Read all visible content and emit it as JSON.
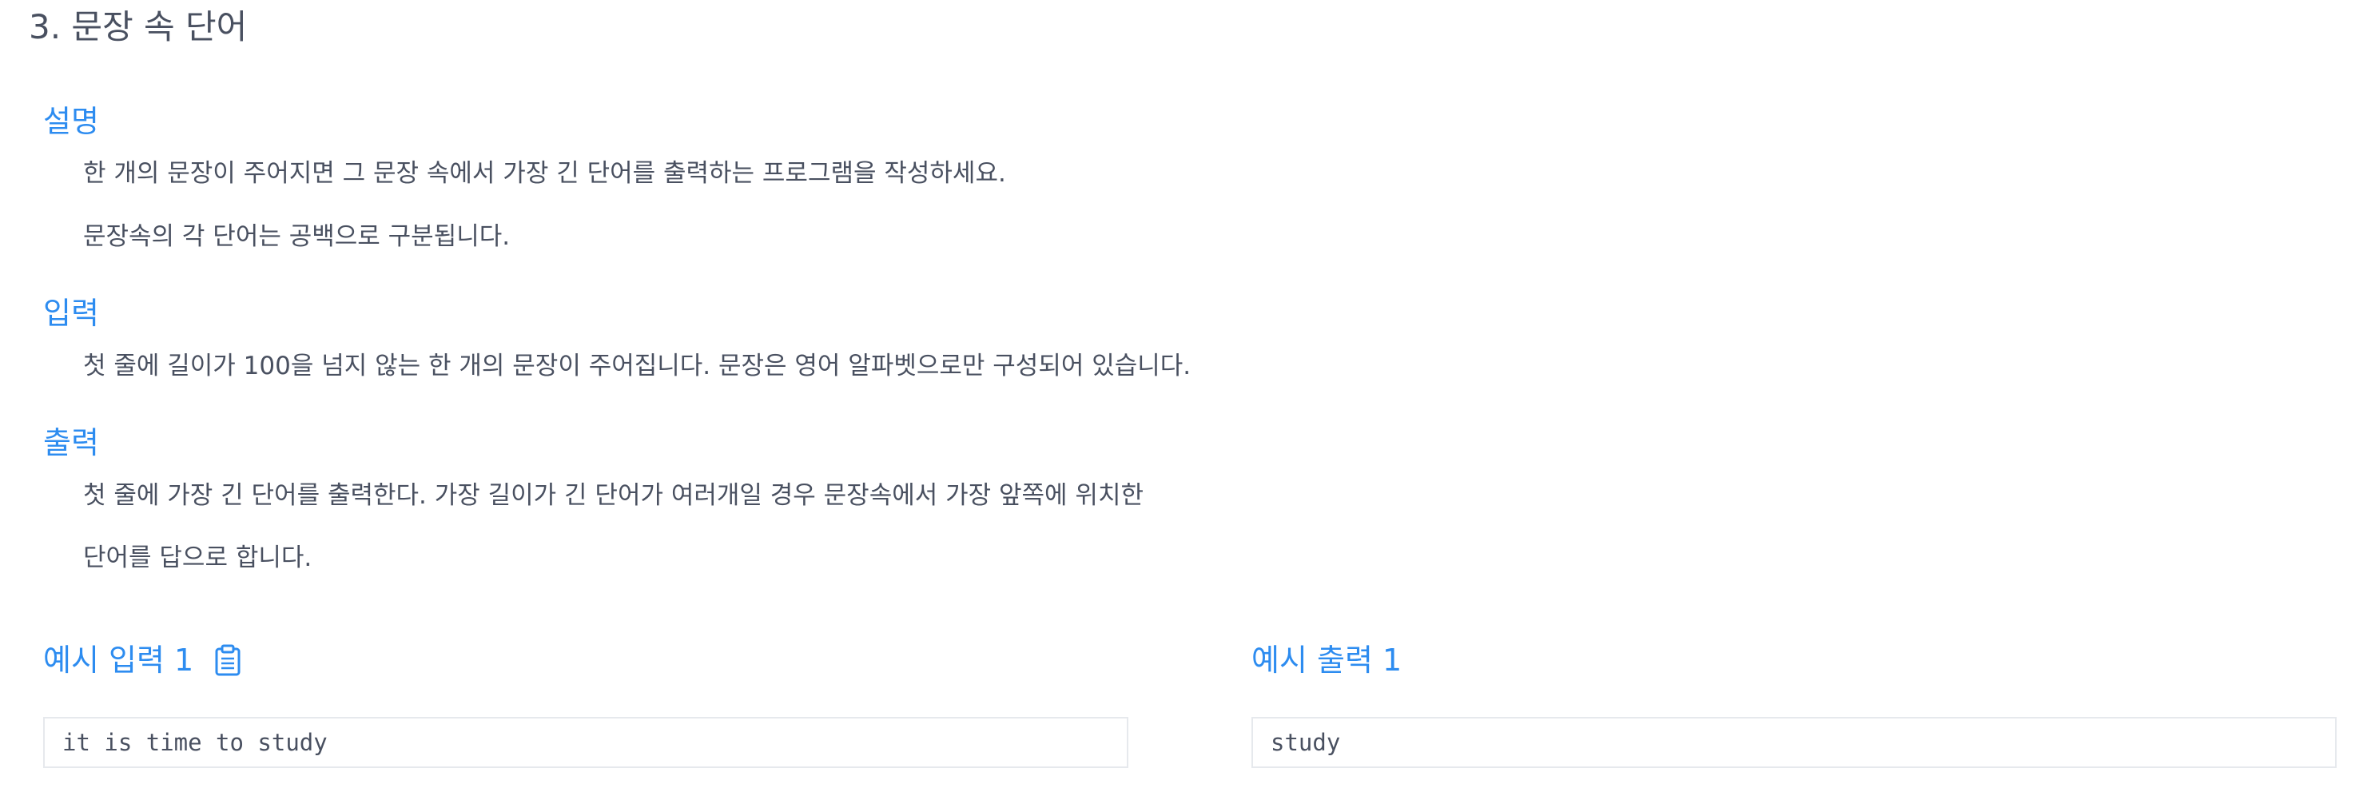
{
  "problem": {
    "title": "3. 문장 속 단어"
  },
  "description": {
    "heading": "설명",
    "lines": [
      "한 개의 문장이 주어지면 그 문장 속에서 가장 긴 단어를 출력하는 프로그램을 작성하세요.",
      "문장속의 각 단어는 공백으로 구분됩니다."
    ]
  },
  "input": {
    "heading": "입력",
    "lines": [
      "첫 줄에 길이가 100을 넘지 않는 한 개의 문장이 주어집니다. 문장은 영어 알파벳으로만 구성되어 있습니다."
    ]
  },
  "output": {
    "heading": "출력",
    "lines": [
      "첫 줄에 가장 긴 단어를 출력한다. 가장 길이가 긴 단어가 여러개일 경우 문장속에서 가장 앞쪽에 위치한",
      "단어를 답으로 합니다."
    ]
  },
  "samples": {
    "input_heading": "예시 입력 1",
    "input_value": "it is time to study",
    "output_heading": "예시 출력 1",
    "output_value": "study",
    "copy_icon": "clipboard-icon",
    "accent_color": "#2d8cf0",
    "text_color": "#495060",
    "border_color": "#e6e9ed"
  }
}
